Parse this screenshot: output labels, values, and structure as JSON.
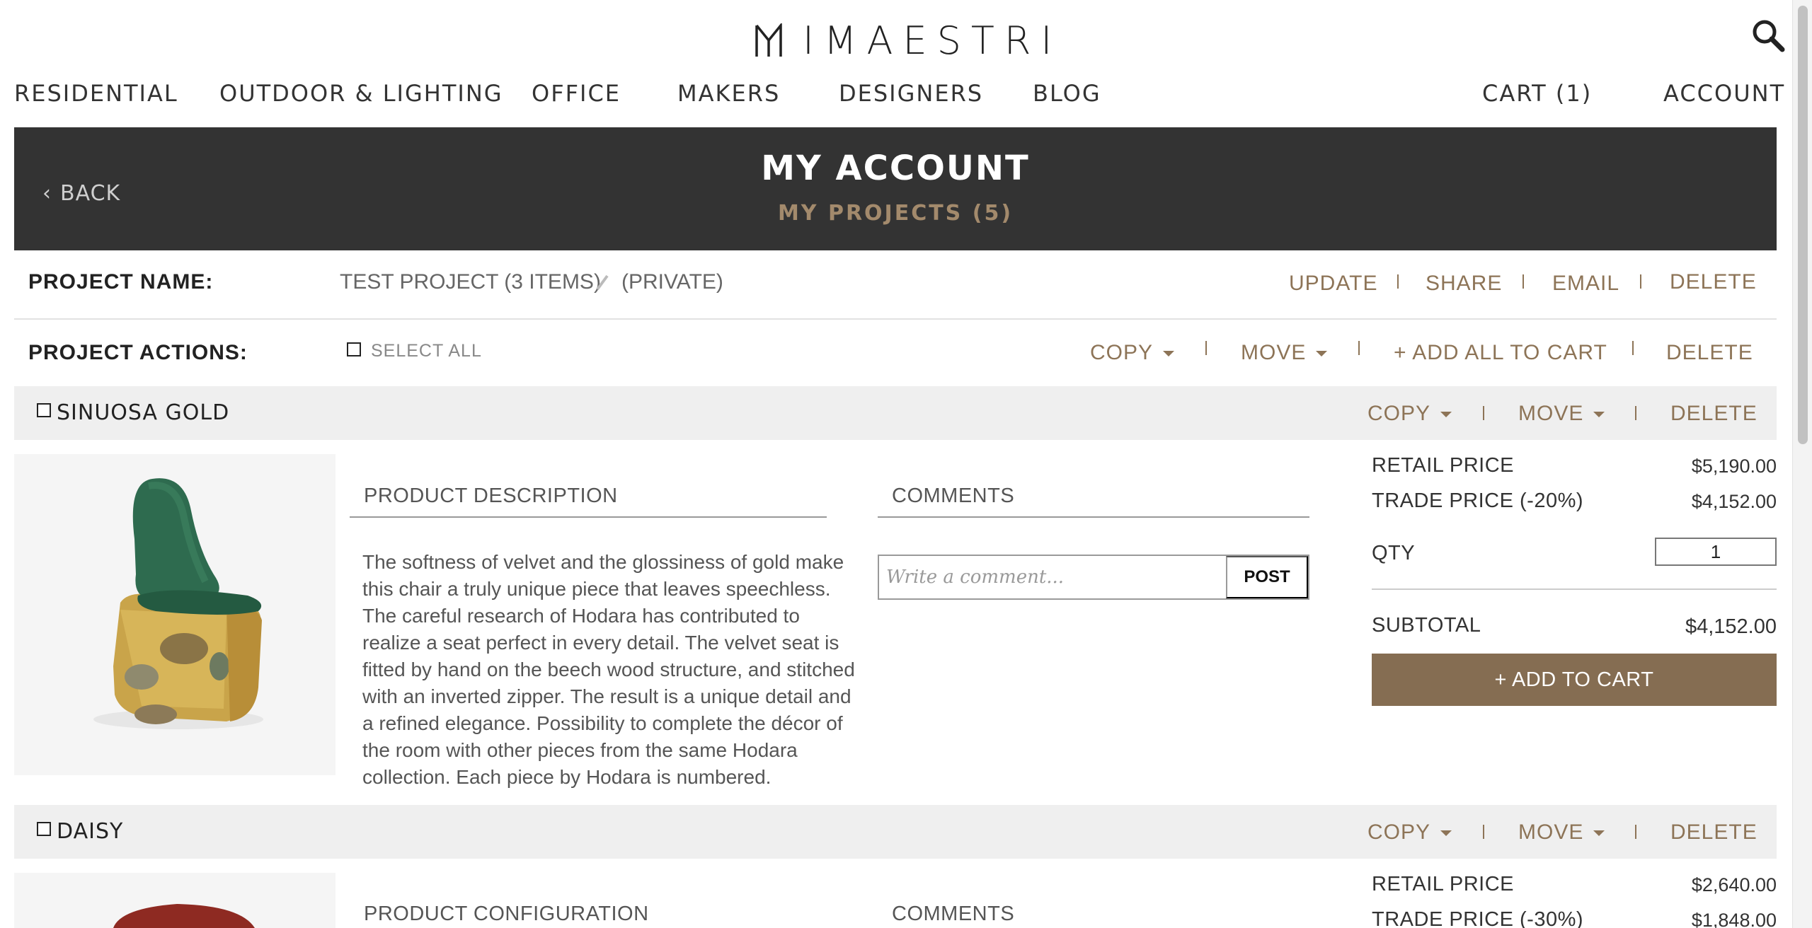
{
  "brand": {
    "name": "IMAESTRI"
  },
  "nav": {
    "residential": "RESIDENTIAL",
    "outdoor": "OUTDOOR & LIGHTING",
    "office": "OFFICE",
    "makers": "MAKERS",
    "designers": "DESIGNERS",
    "blog": "BLOG",
    "cart": "CART (1)",
    "account": "ACCOUNT"
  },
  "banner": {
    "back": "BACK",
    "title": "MY ACCOUNT",
    "subtitle": "MY PROJECTS (5)"
  },
  "project": {
    "name_label": "PROJECT NAME:",
    "name_value": "TEST PROJECT (3 ITEMS)",
    "visibility": "(PRIVATE)",
    "update": "UPDATE",
    "share": "SHARE",
    "email": "EMAIL",
    "delete": "DELETE",
    "actions_label": "PROJECT ACTIONS:",
    "select_all": "SELECT ALL",
    "copy": "COPY",
    "move": "MOVE",
    "add_all": "+ ADD ALL TO CART",
    "actions_delete": "DELETE"
  },
  "products": [
    {
      "name": "SINUOSA GOLD",
      "copy": "COPY",
      "move": "MOVE",
      "delete": "DELETE",
      "section_title": "PRODUCT DESCRIPTION",
      "comments_title": "COMMENTS",
      "description": "The softness of velvet and the glossiness of gold make this chair a truly unique piece that leaves speechless. The careful research of Hodara has contributed to realize a seat perfect in every detail. The velvet seat is fitted by hand on the beech wood structure, and stitched with an inverted zipper. The result is a unique detail and a refined elegance. Possibility to complete the décor of the room with other pieces from the same Hodara collection. Each piece by Hodara is numbered.",
      "comment_placeholder": "Write a comment...",
      "post": "POST",
      "retail_label": "RETAIL PRICE",
      "retail_price": "$5,190.00",
      "trade_label": "TRADE PRICE (-20%)",
      "trade_price": "$4,152.00",
      "qty_label": "QTY",
      "qty": "1",
      "subtotal_label": "SUBTOTAL",
      "subtotal": "$4,152.00",
      "add_to_cart": "+ ADD TO CART"
    },
    {
      "name": "DAISY",
      "copy": "COPY",
      "move": "MOVE",
      "delete": "DELETE",
      "section_title": "PRODUCT CONFIGURATION",
      "comments_title": "COMMENTS",
      "retail_label": "RETAIL PRICE",
      "retail_price": "$2,640.00",
      "trade_label": "TRADE PRICE (-30%)",
      "trade_price": "$1,848.00"
    }
  ],
  "colors": {
    "accent": "#8d7457",
    "banner": "#333333",
    "button": "#856d52",
    "bar": "#efefef"
  }
}
